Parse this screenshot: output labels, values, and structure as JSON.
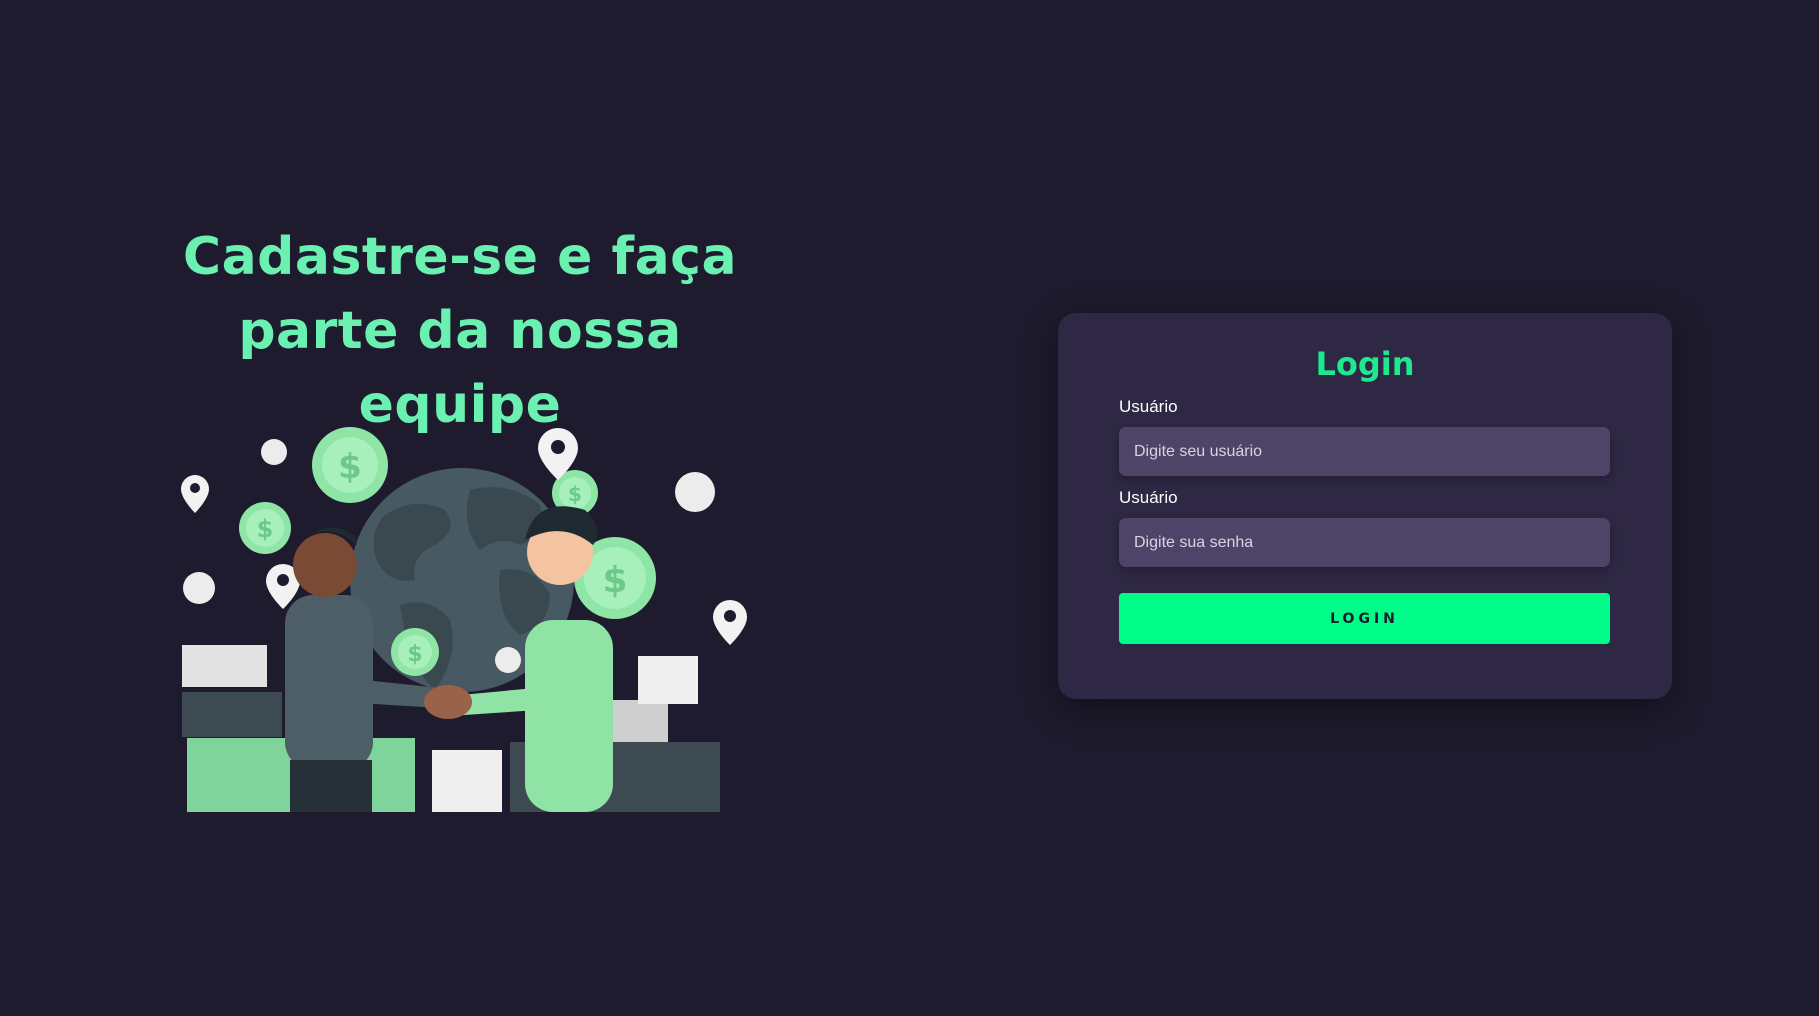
{
  "hero": {
    "title_line1": "Cadastre-se e faça",
    "title_line2": "parte da nossa equipe",
    "illustration_icon": "handshake-globe-money-illustration"
  },
  "login": {
    "title": "Login",
    "username_label": "Usuário",
    "username_placeholder": "Digite seu usuário",
    "password_label": "Usuário",
    "password_placeholder": "Digite sua senha",
    "button_label": "LOGIN"
  },
  "colors": {
    "background": "#1f1b2e",
    "card": "#2e2844",
    "input": "#4d4468",
    "accent": "#1de98f",
    "button": "#00fd8a",
    "hero_text": "#6af0b0"
  }
}
